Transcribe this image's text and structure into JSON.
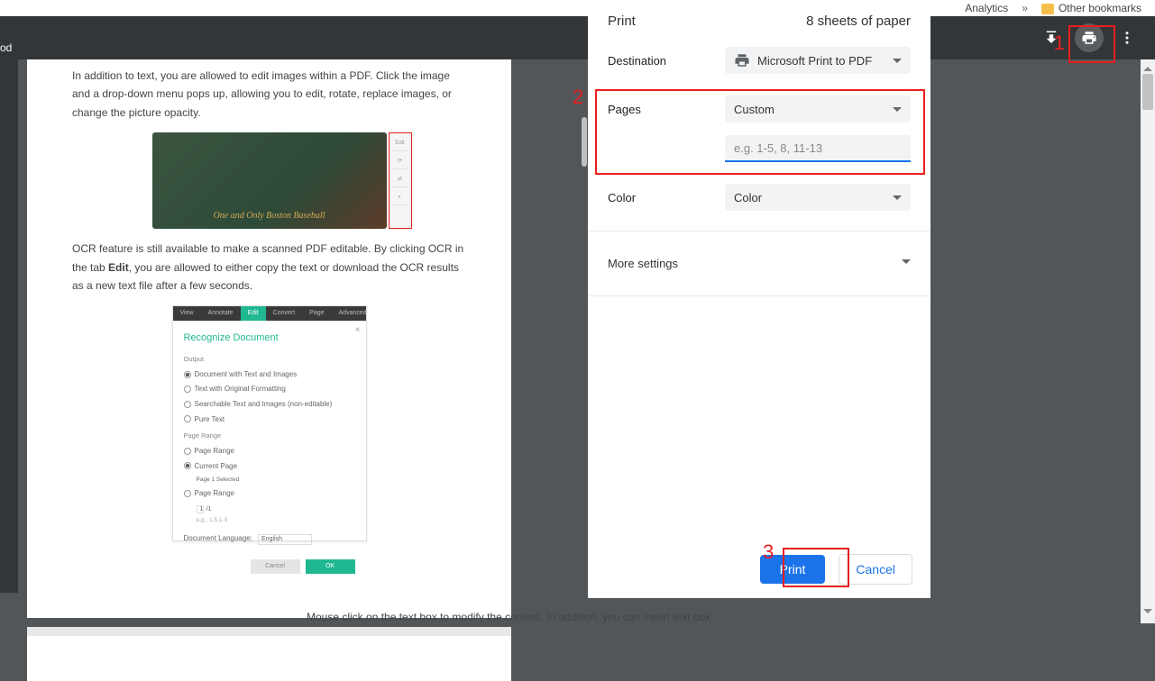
{
  "bookmarks": {
    "item1": "Analytics",
    "expand": "»",
    "other": "Other bookmarks"
  },
  "left_edge": "od",
  "doc": {
    "p1": "In addition to text, you are allowed to edit images within a PDF. Click the image and a drop-down menu pops up, allowing you to edit, rotate, replace images, or change the picture opacity.",
    "illus1_caption": "One and Only Boston Baseball",
    "p2a": "OCR feature is still available to make a scanned PDF editable. By clicking OCR in the tab ",
    "p2b": "Edit",
    "p2c": ", you are allowed to either copy the text or download the OCR results as a new text file after a few seconds.",
    "illus2": {
      "tabs": [
        "View",
        "Annotate",
        "Edit",
        "Convert",
        "Page",
        "Advanced"
      ],
      "title": "Recognize Document",
      "section1": "Output",
      "opt1": "Document with Text and Images",
      "opt2": "Text with Original Formatting",
      "opt3": "Searchable Text and Images (non-editable)",
      "opt4": "Pure Text",
      "section2": "Page Range",
      "pr1": "Page Range",
      "pr2": "Current Page",
      "pr2_sub": "Page 1 Selected",
      "pr3": "Page Range",
      "page_val": "1",
      "page_total": "/1",
      "page_hint": "e.g., 1,5,1-9",
      "lang_label": "Document Language:",
      "lang_val": "English",
      "cancel": "Cancel",
      "ok": "OK"
    },
    "bottom": "Mouse click on the text box to modify the content. In addition, you can insert text box"
  },
  "print": {
    "title": "Print",
    "sheets": "8 sheets of paper",
    "dest_label": "Destination",
    "dest_value": "Microsoft Print to PDF",
    "pages_label": "Pages",
    "pages_value": "Custom",
    "pages_placeholder": "e.g. 1-5, 8, 11-13",
    "color_label": "Color",
    "color_value": "Color",
    "more": "More settings",
    "print_btn": "Print",
    "cancel_btn": "Cancel"
  },
  "anno": {
    "n1": "1",
    "n2": "2",
    "n3": "3"
  }
}
